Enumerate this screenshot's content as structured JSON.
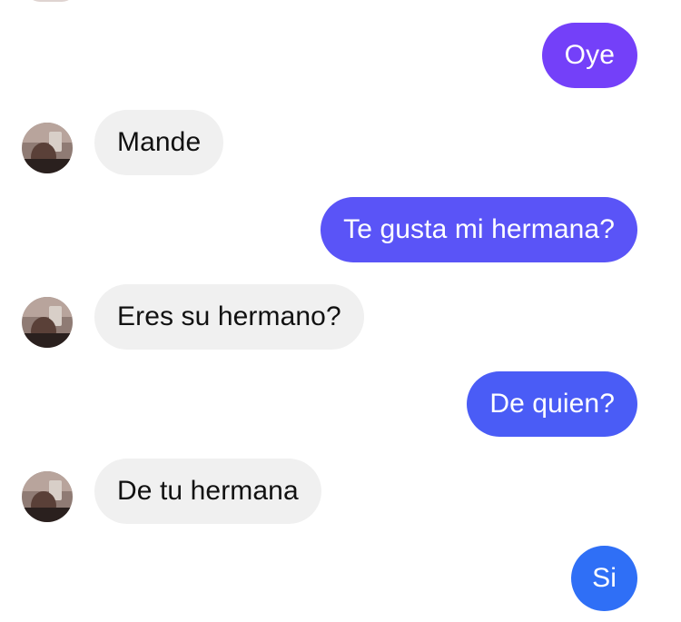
{
  "conversation": {
    "messages": [
      {
        "sender": "me",
        "text": "Oye",
        "color": "#7440f9"
      },
      {
        "sender": "contact",
        "text": "Mande"
      },
      {
        "sender": "me",
        "text": "Te gusta mi hermana?",
        "color": "#5a54f7"
      },
      {
        "sender": "contact",
        "text": "Eres su hermano?"
      },
      {
        "sender": "me",
        "text": "De quien?",
        "color": "#4a5cf6"
      },
      {
        "sender": "contact",
        "text": "De tu hermana"
      },
      {
        "sender": "me",
        "text": "Si",
        "color": "#2f6ff6"
      }
    ]
  },
  "icons": {
    "contact_avatar": "profile-photo-avatar"
  },
  "theme": {
    "incoming_bubble": "#f0f0f0",
    "outgoing_text": "#ffffff",
    "incoming_text": "#111111"
  }
}
